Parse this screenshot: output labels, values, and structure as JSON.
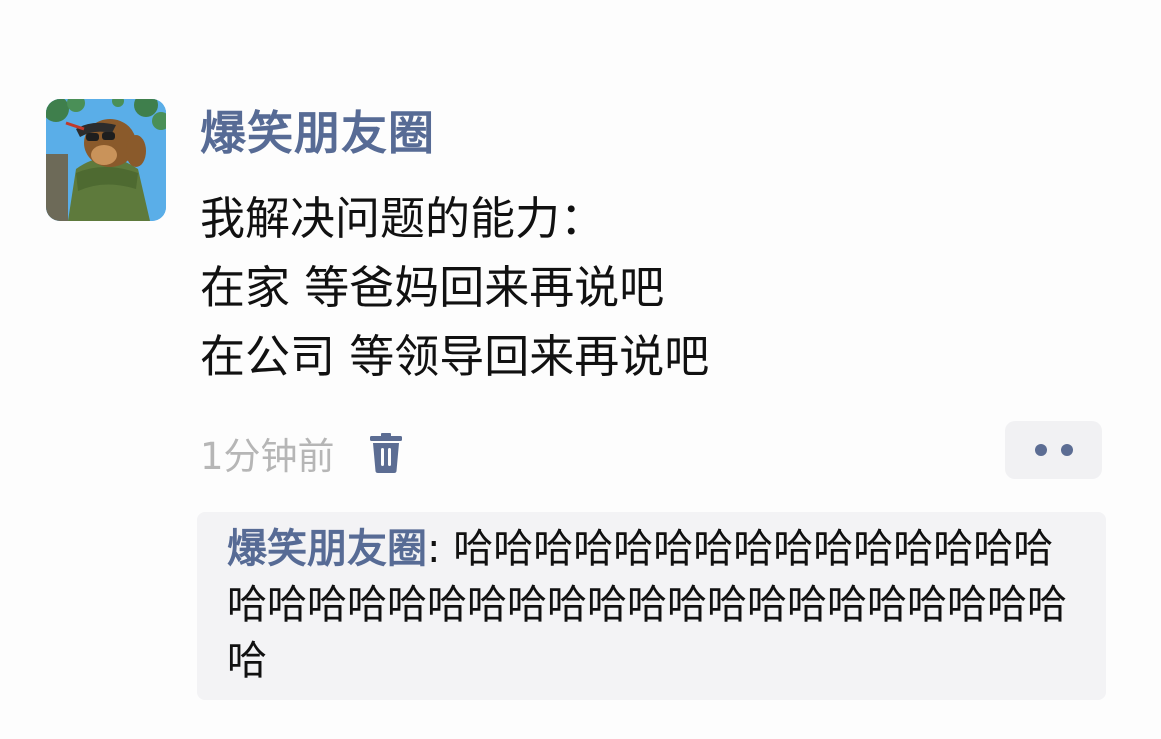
{
  "post": {
    "author": "爆笑朋友圈",
    "content_lines": [
      "我解决问题的能力：",
      "在家 等爸妈回来再说吧",
      "在公司 等领导回来再说吧"
    ],
    "timestamp": "1分钟前",
    "avatar_icon": "cartoon-bear-avatar"
  },
  "actions": {
    "delete_icon": "trash-icon",
    "more_icon": "more-dots-icon"
  },
  "comments": [
    {
      "author": "爆笑朋友圈",
      "separator": ": ",
      "text": "哈哈哈哈哈哈哈哈哈哈哈哈哈哈哈哈哈哈哈哈哈哈哈哈哈哈哈哈哈哈哈哈哈哈哈哈哈"
    }
  ],
  "colors": {
    "name_blue": "#576b95",
    "icon_blue": "#5c6d93",
    "text": "#111111",
    "muted": "#b6b6b6",
    "comment_bg": "#f3f3f5"
  }
}
